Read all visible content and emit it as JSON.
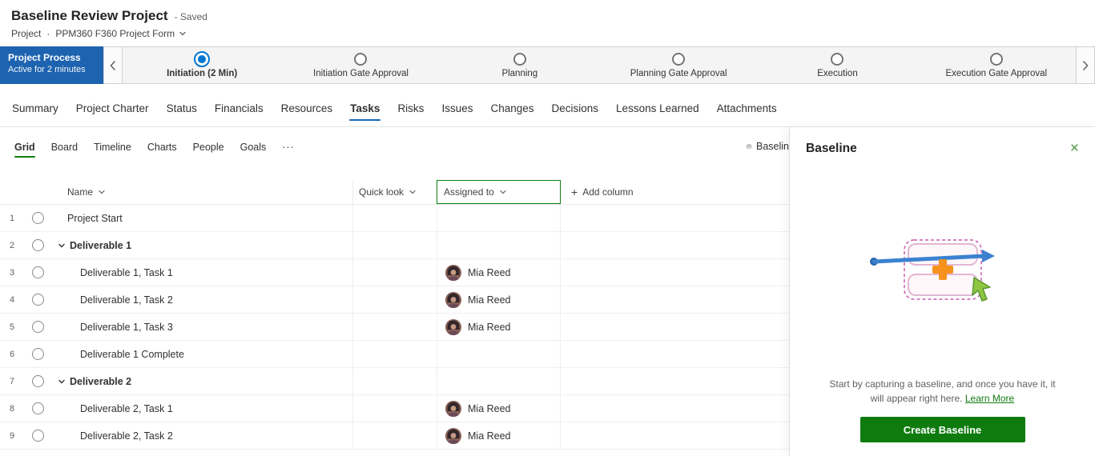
{
  "header": {
    "title": "Baseline Review Project",
    "saved": "- Saved",
    "breadcrumb_app": "Project",
    "breadcrumb_sep": "·",
    "breadcrumb_form": "PPM360 F360 Project Form"
  },
  "process": {
    "name": "Project Process",
    "status": "Active for 2 minutes",
    "steps": [
      {
        "label": "Initiation (2 Min)",
        "state": "active"
      },
      {
        "label": "Initiation Gate Approval",
        "state": "pending"
      },
      {
        "label": "Planning",
        "state": "pending"
      },
      {
        "label": "Planning Gate Approval",
        "state": "pending"
      },
      {
        "label": "Execution",
        "state": "pending"
      },
      {
        "label": "Execution Gate Approval",
        "state": "pending"
      }
    ]
  },
  "nav_tabs": {
    "active": "Tasks",
    "items": [
      "Summary",
      "Project Charter",
      "Status",
      "Financials",
      "Resources",
      "Tasks",
      "Risks",
      "Issues",
      "Changes",
      "Decisions",
      "Lessons Learned",
      "Attachments"
    ]
  },
  "view_tabs": {
    "active": "Grid",
    "items": [
      "Grid",
      "Board",
      "Timeline",
      "Charts",
      "People",
      "Goals"
    ],
    "more": "···"
  },
  "toolbar": {
    "baseline_label": "Baselin"
  },
  "grid": {
    "headers": {
      "name": "Name",
      "quick_look": "Quick look",
      "assigned_to": "Assigned to",
      "add_plus": "+",
      "add_column": "Add column"
    },
    "rows": [
      {
        "num": "1",
        "name": "Project Start",
        "assigned": ""
      },
      {
        "num": "2",
        "name": "Deliverable 1",
        "assigned": ""
      },
      {
        "num": "3",
        "name": "Deliverable 1, Task 1",
        "assigned": "Mia Reed"
      },
      {
        "num": "4",
        "name": "Deliverable 1, Task 2",
        "assigned": "Mia Reed"
      },
      {
        "num": "5",
        "name": "Deliverable 1, Task 3",
        "assigned": "Mia Reed"
      },
      {
        "num": "6",
        "name": "Deliverable 1 Complete",
        "assigned": ""
      },
      {
        "num": "7",
        "name": "Deliverable 2",
        "assigned": ""
      },
      {
        "num": "8",
        "name": "Deliverable 2, Task 1",
        "assigned": "Mia Reed"
      },
      {
        "num": "9",
        "name": "Deliverable 2, Task 2",
        "assigned": "Mia Reed"
      }
    ]
  },
  "panel": {
    "title": "Baseline",
    "close": "×",
    "body": "Start by capturing a baseline, and once you have it, it will appear right here.",
    "learn_more": "Learn More",
    "cta": "Create Baseline"
  },
  "colors": {
    "process_bar_blue": "#1d63b0",
    "active_step_blue": "#0078d4",
    "tab_underline_blue": "#0f6cbd",
    "grid_underline_green": "#107c10",
    "selected_column_green": "#107c10",
    "cta_green": "#0f7b0f",
    "link_green": "#107c10"
  }
}
